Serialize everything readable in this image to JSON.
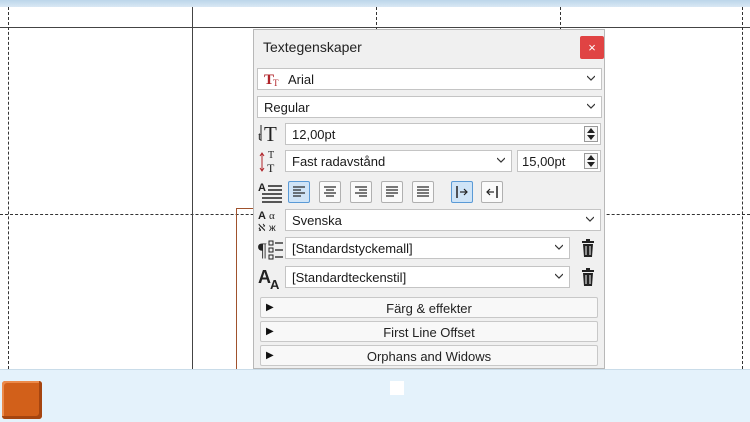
{
  "panel": {
    "title": "Textegenskaper",
    "close_label": "×",
    "font_family": "Arial",
    "font_style": "Regular",
    "font_size": "12,00pt",
    "leading_mode": "Fast radavstånd",
    "leading_value": "15,00pt",
    "language": "Svenska",
    "paragraph_style": "[Standardstyckemall]",
    "character_style": "[Standardteckenstil]",
    "sections": [
      {
        "label": "Färg & effekter"
      },
      {
        "label": "First Line Offset"
      },
      {
        "label": "Orphans and Widows"
      }
    ],
    "alignment_selected": "left",
    "direction_selected": "ltr"
  },
  "colors": {
    "close_button": "#e04343",
    "active_button": "#cfe4f7",
    "accent_orange": "#d2601a",
    "bottom_bar": "#e4f2fb"
  }
}
